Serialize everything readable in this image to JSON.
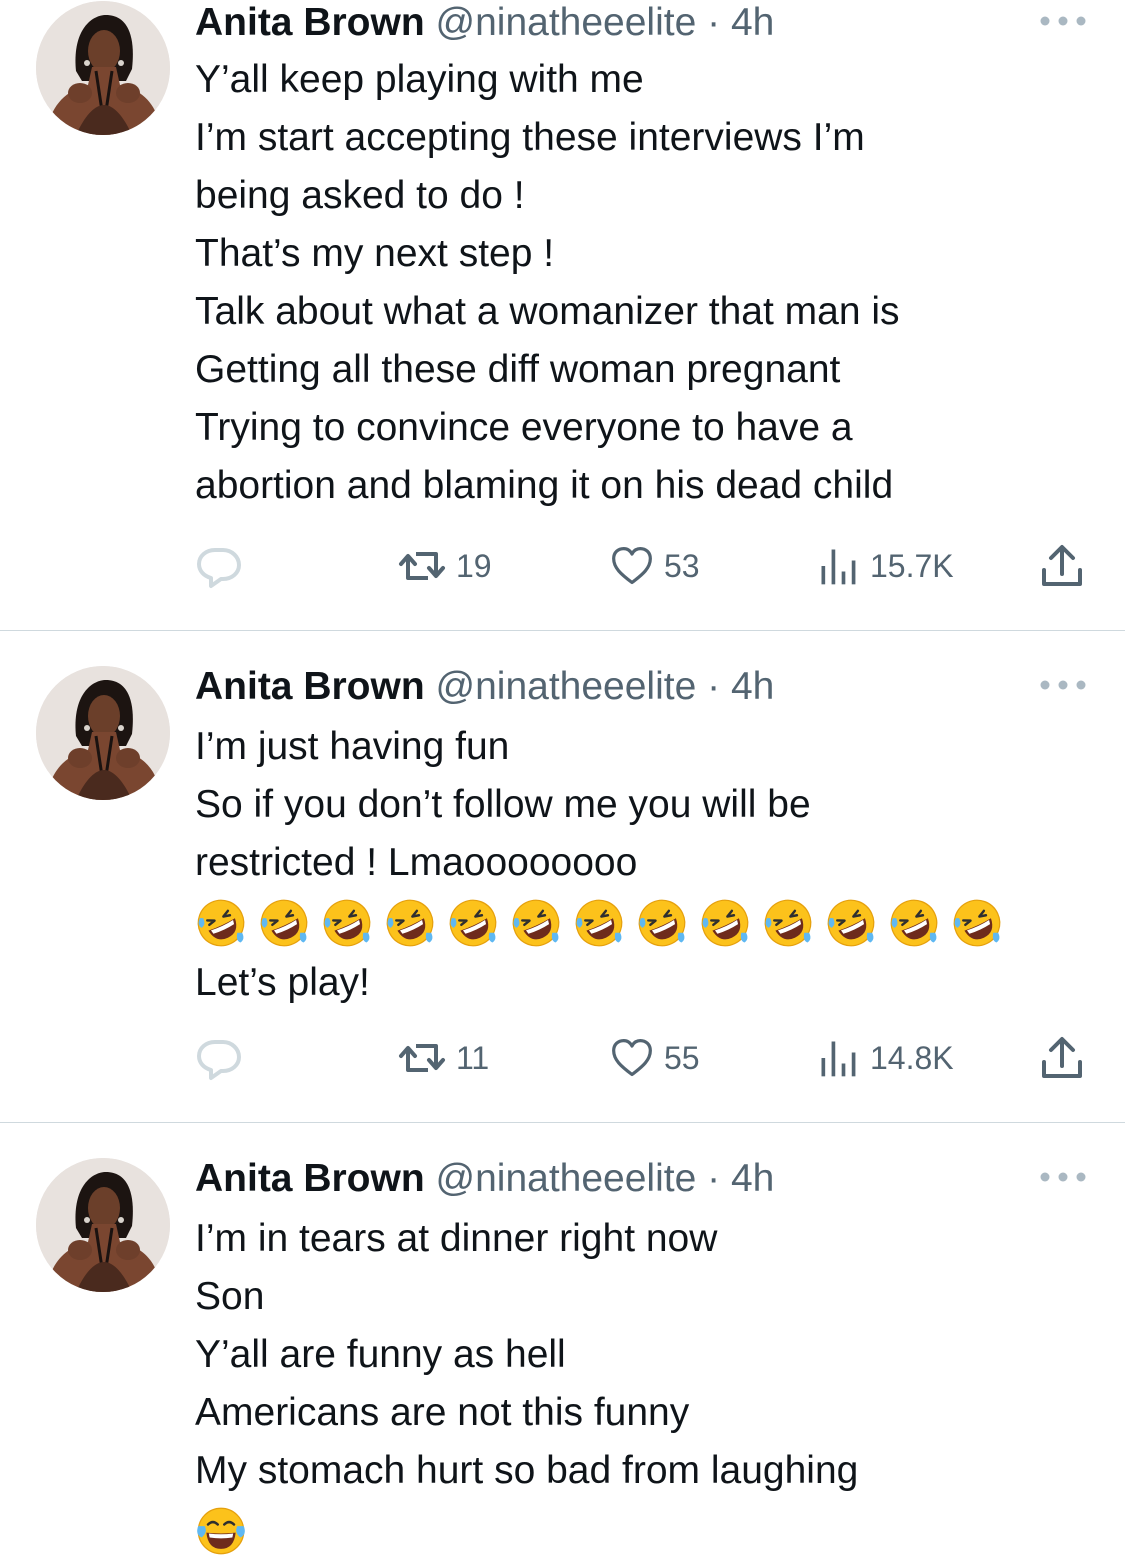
{
  "tweets": [
    {
      "author_name": "Anita Brown",
      "handle": "@ninatheeelite",
      "separator": "·",
      "time": "4h",
      "lines": [
        "Y’all keep playing with me",
        "I’m start accepting these interviews I’m",
        "being asked to do !",
        "That’s my next step !",
        "Talk about what a womanizer that man is",
        "Getting all these diff woman pregnant",
        "Trying to convince everyone to have a",
        "abortion and blaming it on his dead child"
      ],
      "replies": "",
      "retweets": "19",
      "likes": "53",
      "views": "15.7K"
    },
    {
      "author_name": "Anita Brown",
      "handle": "@ninatheeelite",
      "separator": "·",
      "time": "4h",
      "lines": [
        "I’m just having fun",
        "So if you don’t follow me you will be",
        "restricted ! Lmaoooooooo"
      ],
      "emoji_line": "🤣🤣🤣🤣🤣🤣🤣🤣🤣🤣🤣🤣🤣",
      "after_lines": [
        "Let’s play!"
      ],
      "replies": "",
      "retweets": "11",
      "likes": "55",
      "views": "14.8K"
    },
    {
      "author_name": "Anita Brown",
      "handle": "@ninatheeelite",
      "separator": "·",
      "time": "4h",
      "lines": [
        "I’m in tears at dinner right now",
        "Son",
        "Y’all are funny as hell",
        "Americans are not this funny",
        "My stomach hurt so bad from laughing"
      ],
      "emoji_line": "😂"
    }
  ],
  "icons": {
    "reply": "speech-bubble-icon",
    "retweet": "retweet-icon",
    "like": "heart-icon",
    "views": "bar-chart-icon",
    "share": "share-upload-icon",
    "more": "more-dots-icon",
    "rofl_emoji": "rolling-on-floor-laughing-emoji",
    "joy_emoji": "tears-of-joy-emoji"
  },
  "colors": {
    "text_primary": "#0f1419",
    "text_secondary": "#536471",
    "action_icon": "#536471",
    "reply_icon": "#cfd9de",
    "divider": "#cfd9de",
    "background": "#ffffff"
  }
}
